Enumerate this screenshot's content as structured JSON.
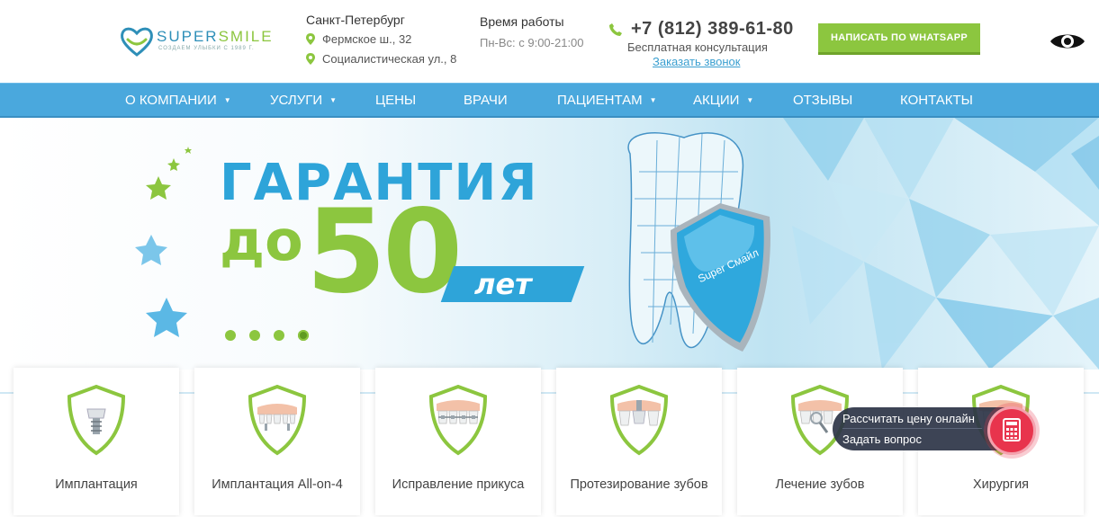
{
  "header": {
    "logo": {
      "word_a": "SUPER",
      "word_b": "SMILE",
      "tagline": "создаем улыбки с 1989 г."
    },
    "city": "Санкт-Петербург",
    "addresses": [
      "Фермское ш., 32",
      "Социалистическая ул., 8"
    ],
    "hours_title": "Время работы",
    "hours_value": "Пн-Вс: с 9:00-21:00",
    "phone": "+7 (812) 389-61-80",
    "consult": "Бесплатная консультация",
    "callback": "Заказать звонок",
    "whatsapp_button": "НАПИСАТЬ ПО WHATSAPP",
    "accessibility_icon": "eye-icon"
  },
  "nav": {
    "items": [
      {
        "label": "О КОМПАНИИ",
        "dropdown": true
      },
      {
        "label": "УСЛУГИ",
        "dropdown": true
      },
      {
        "label": "ЦЕНЫ",
        "dropdown": false
      },
      {
        "label": "ВРАЧИ",
        "dropdown": false
      },
      {
        "label": "ПАЦИЕНТАМ",
        "dropdown": true
      },
      {
        "label": "АКЦИИ",
        "dropdown": true
      },
      {
        "label": "ОТЗЫВЫ",
        "dropdown": false
      },
      {
        "label": "КОНТАКТЫ",
        "dropdown": false
      }
    ]
  },
  "hero": {
    "line1": "ГАРАНТИЯ",
    "line2_prefix": "до",
    "line2_number": "50",
    "line2_suffix": "лет",
    "shield_text": "Super Смайл",
    "slides_total": 4,
    "active_slide": 4
  },
  "services": [
    {
      "label": "Имплантация",
      "icon": "implant-icon"
    },
    {
      "label": "Имплантация All-on-4",
      "icon": "all-on-4-icon"
    },
    {
      "label": "Исправление прикуса",
      "icon": "braces-icon"
    },
    {
      "label": "Протезирование зубов",
      "icon": "prosthetics-icon"
    },
    {
      "label": "Лечение зубов",
      "icon": "treatment-icon"
    },
    {
      "label": "Хирургия",
      "icon": "surgery-icon"
    }
  ],
  "widget": {
    "calc": "Рассчитать цену онлайн",
    "ask": "Задать вопрос",
    "button_icon": "calculator-icon"
  },
  "colors": {
    "brand_blue": "#4aa8dd",
    "brand_green": "#8cc63f",
    "widget_red": "#e8344d"
  }
}
